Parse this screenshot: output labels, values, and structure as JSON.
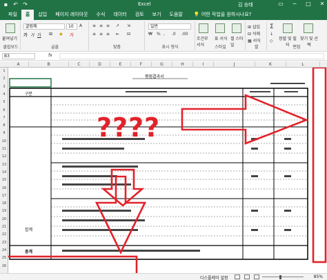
{
  "app": {
    "title": "Excel",
    "user": "김 승태",
    "qat_icons": [
      "save-icon",
      "undo-icon",
      "redo-icon"
    ],
    "window_buttons": [
      "ribbon-options-icon",
      "minimize-icon",
      "maximize-icon",
      "close-icon"
    ]
  },
  "tabs": [
    {
      "label": "파일",
      "active": false
    },
    {
      "label": "홈",
      "active": true
    },
    {
      "label": "삽입",
      "active": false
    },
    {
      "label": "페이지 레이아웃",
      "active": false
    },
    {
      "label": "수식",
      "active": false
    },
    {
      "label": "데이터",
      "active": false
    },
    {
      "label": "검토",
      "active": false
    },
    {
      "label": "보기",
      "active": false
    },
    {
      "label": "도움말",
      "active": false
    }
  ],
  "search": {
    "label": "어떤 작업을 원하시나요?"
  },
  "ribbon": {
    "clipboard": {
      "label": "클립보드",
      "paste": "붙여넣기"
    },
    "font": {
      "label": "글꼴",
      "font_name": "굴림체",
      "font_size": "10"
    },
    "alignment": {
      "label": "맞춤"
    },
    "number": {
      "label": "표시 형식",
      "format": "일반"
    },
    "styles": {
      "label": "스타일",
      "cond": "조건부 서식",
      "table": "표 서식",
      "cell": "셀 스타일"
    },
    "cells": {
      "label": "셀",
      "insert": "삽입",
      "delete": "삭제",
      "format": "서식"
    },
    "editing": {
      "label": "편집",
      "sort": "정렬 및 필터",
      "find": "찾기 및 선택"
    }
  },
  "formula_bar": {
    "name_box": "B3",
    "fx": "fx",
    "value": ""
  },
  "columns": [
    "A",
    "B",
    "C",
    "D",
    "E",
    "F",
    "G",
    "H",
    "I",
    "J",
    "K",
    "L"
  ],
  "rows": [
    "1",
    "2",
    "3",
    "4",
    "5",
    "6",
    "7",
    "8",
    "9",
    "10",
    "11",
    "12",
    "13",
    "14",
    "15",
    "16",
    "17",
    "18",
    "19",
    "20",
    "21",
    "22",
    "23",
    "24",
    "25",
    "26"
  ],
  "sheet": {
    "title": "평점결과서",
    "cells": [
      {
        "row": "4",
        "text": "구분"
      },
      {
        "row": "16",
        "text": "합계"
      },
      {
        "row": "24",
        "text": "총계"
      }
    ]
  },
  "annotation": {
    "question_marks": "????",
    "color": "#e2222a"
  },
  "status": {
    "page_layout_label": "디스플레이 설정",
    "zoom": "85%"
  }
}
